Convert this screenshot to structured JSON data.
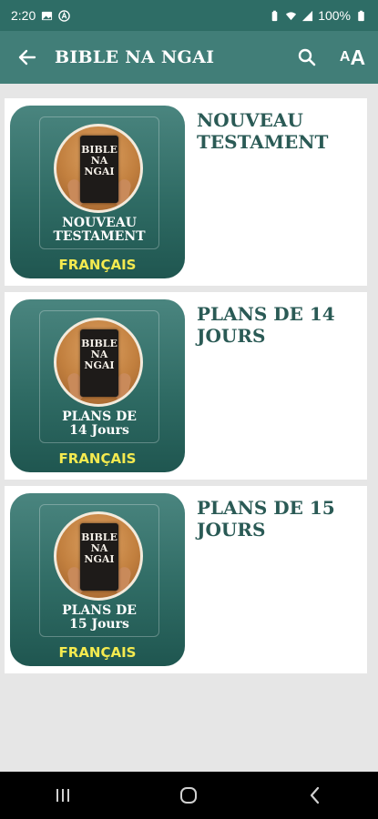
{
  "status": {
    "time": "2:20",
    "battery": "100%"
  },
  "app_bar": {
    "title": "BIBLE NA NGAI",
    "back_icon": "arrow-left-icon",
    "search_icon": "search-icon",
    "font_size_label_small": "A",
    "font_size_label_big": "A"
  },
  "items": [
    {
      "title": "NOUVEAU TESTAMENT",
      "book_text": "BIBLE NA NGAI",
      "subtitle_line1": "NOUVEAU",
      "subtitle_line2": "TESTAMENT",
      "language": "FRANÇAIS"
    },
    {
      "title": "PLANS DE 14 JOURS",
      "book_text": "BIBLE NA NGAI",
      "subtitle_line1": "PLANS DE",
      "subtitle_line2": "14 Jours",
      "language": "FRANÇAIS"
    },
    {
      "title": "PLANS DE 15 JOURS",
      "book_text": "BIBLE NA NGAI",
      "subtitle_line1": "PLANS DE",
      "subtitle_line2": "15 Jours",
      "language": "FRANÇAIS"
    }
  ],
  "colors": {
    "app_bar": "#417e78",
    "status_bar": "#2e6d66",
    "title_text": "#2a5a55",
    "language_text": "#f5ea4f"
  }
}
